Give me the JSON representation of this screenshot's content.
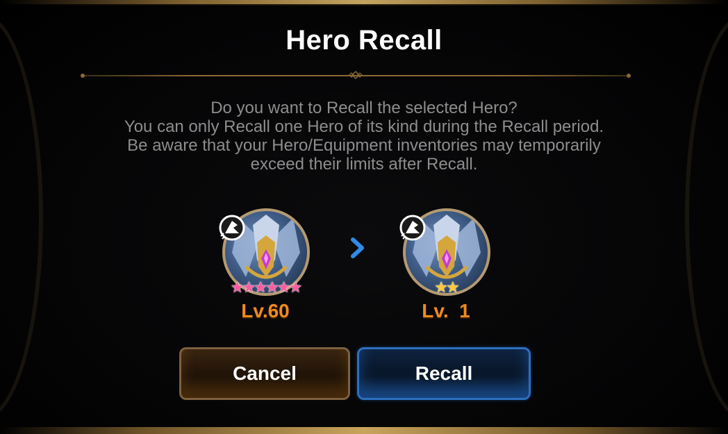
{
  "dialog": {
    "title": "Hero Recall",
    "message_lines": [
      "Do you want to Recall the selected Hero?",
      "You can only Recall one Hero of its kind during the Recall period.",
      "Be aware that your Hero/Equipment inventories may temporarily",
      "exceed their limits after Recall."
    ]
  },
  "hero_before": {
    "level_label": "Lv.60",
    "stars": 6,
    "star_color": "#ff5aa0",
    "class_icon": "knight-class-icon"
  },
  "hero_after": {
    "level_label": "Lv.  1",
    "stars": 2,
    "star_color": "#ffc83a",
    "class_icon": "knight-class-icon"
  },
  "arrow_icon": "chevron-right-icon",
  "buttons": {
    "cancel_label": "Cancel",
    "recall_label": "Recall"
  },
  "colors": {
    "level_text": "#f08a1e",
    "message_text": "#8d8d8d",
    "accent_gold": "#8a6a33",
    "recall_border": "#2d6fc0"
  }
}
